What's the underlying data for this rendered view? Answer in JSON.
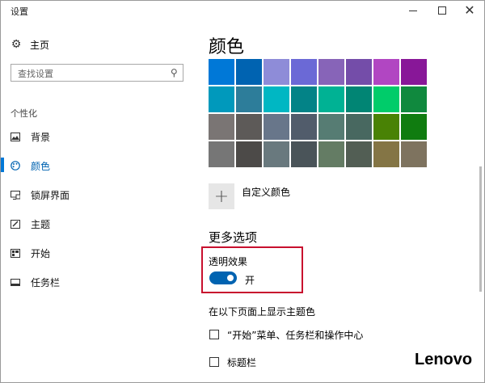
{
  "window": {
    "title": "设置",
    "minimize_icon": "minimize-icon",
    "maximize_icon": "maximize-icon",
    "close_icon": "close-icon"
  },
  "sidebar": {
    "home": {
      "label": "主页",
      "icon": "gear-icon"
    },
    "search": {
      "placeholder": "查找设置",
      "icon": "search-icon"
    },
    "section_title": "个性化",
    "items": [
      {
        "label": "背景",
        "icon": "picture-icon",
        "active": false
      },
      {
        "label": "颜色",
        "icon": "palette-icon",
        "active": true
      },
      {
        "label": "锁屏界面",
        "icon": "monitor-icon",
        "active": false
      },
      {
        "label": "主题",
        "icon": "brush-icon",
        "active": false
      },
      {
        "label": "开始",
        "icon": "start-grid-icon",
        "active": false
      },
      {
        "label": "任务栏",
        "icon": "taskbar-icon",
        "active": false
      }
    ],
    "active_color": "#0078d7"
  },
  "main": {
    "title": "颜色",
    "palette": [
      "#0078d7",
      "#0063b1",
      "#8e8cd8",
      "#6b69d6",
      "#8764b8",
      "#744da9",
      "#b146c2",
      "#881798",
      "#0099bc",
      "#2d7d9a",
      "#00b7c3",
      "#038387",
      "#00b294",
      "#018574",
      "#00cc6a",
      "#10893e",
      "#7a7574",
      "#5d5a58",
      "#68768a",
      "#515c6b",
      "#567c73",
      "#486860",
      "#498205",
      "#107c10",
      "#767676",
      "#4c4a48",
      "#69797e",
      "#4a5459",
      "#647c64",
      "#525e54",
      "#847545",
      "#7e735f"
    ],
    "custom_color": {
      "icon": "plus-icon",
      "label": "自定义颜色"
    },
    "more_options_title": "更多选项",
    "transparency": {
      "label": "透明效果",
      "state": "开",
      "on": true
    },
    "highlight_color": "#c8102e",
    "accent_heading": "在以下页面上显示主题色",
    "checkboxes": [
      {
        "label": "“开始”菜单、任务栏和操作中心",
        "checked": false
      },
      {
        "label": "标题栏",
        "checked": false
      }
    ]
  },
  "watermark": "Lenovo"
}
